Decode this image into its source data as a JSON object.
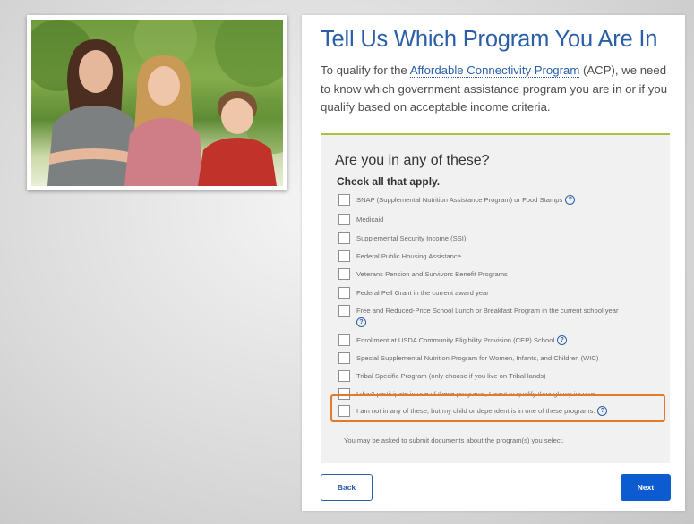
{
  "page": {
    "title": "Tell Us Which Program You Are In",
    "intro_before": "To qualify for the ",
    "intro_link": "Affordable Connectivity Program",
    "intro_after": " (ACP), we need to know which government assistance program you are in or if you qualify based on acceptable income criteria."
  },
  "question": {
    "heading": "Are you in any of these?",
    "subheading": "Check all that apply.",
    "options": [
      {
        "label": "SNAP (Supplemental Nutrition Assistance Program) or Food Stamps",
        "help": true
      },
      {
        "label": "Medicaid",
        "help": false
      },
      {
        "label": "Supplemental Security Income (SSI)",
        "help": false
      },
      {
        "label": "Federal Public Housing Assistance",
        "help": false
      },
      {
        "label": "Veterans Pension and Survivors Benefit Programs",
        "help": false
      },
      {
        "label": "Federal Pell Grant in the current award year",
        "help": false
      },
      {
        "label": "Free and Reduced-Price School Lunch or Breakfast Program in the current school year",
        "help": true
      },
      {
        "label": "Enrollment at USDA Community Eligibility Provision (CEP) School",
        "help": true
      },
      {
        "label": "Special Supplemental Nutrition Program for Women, Infants, and Children (WIC)",
        "help": false
      },
      {
        "label": "Tribal Specific Program (only choose if you live on Tribal lands)",
        "help": false
      },
      {
        "label": "I don't participate in one of these programs, I want to qualify through my income.",
        "help": false
      },
      {
        "label": "I am not in any of these, but my child or dependent is in one of these programs.",
        "help": true
      }
    ],
    "help_glyph": "?",
    "note": "You may be asked to submit documents about the program(s) you select."
  },
  "actions": {
    "back_label": "Back",
    "next_label": "Next"
  },
  "colors": {
    "title": "#2a5fa8",
    "accent_rule": "#a9c23f",
    "highlight": "#e07a2c",
    "primary_button": "#0d5bd1"
  }
}
